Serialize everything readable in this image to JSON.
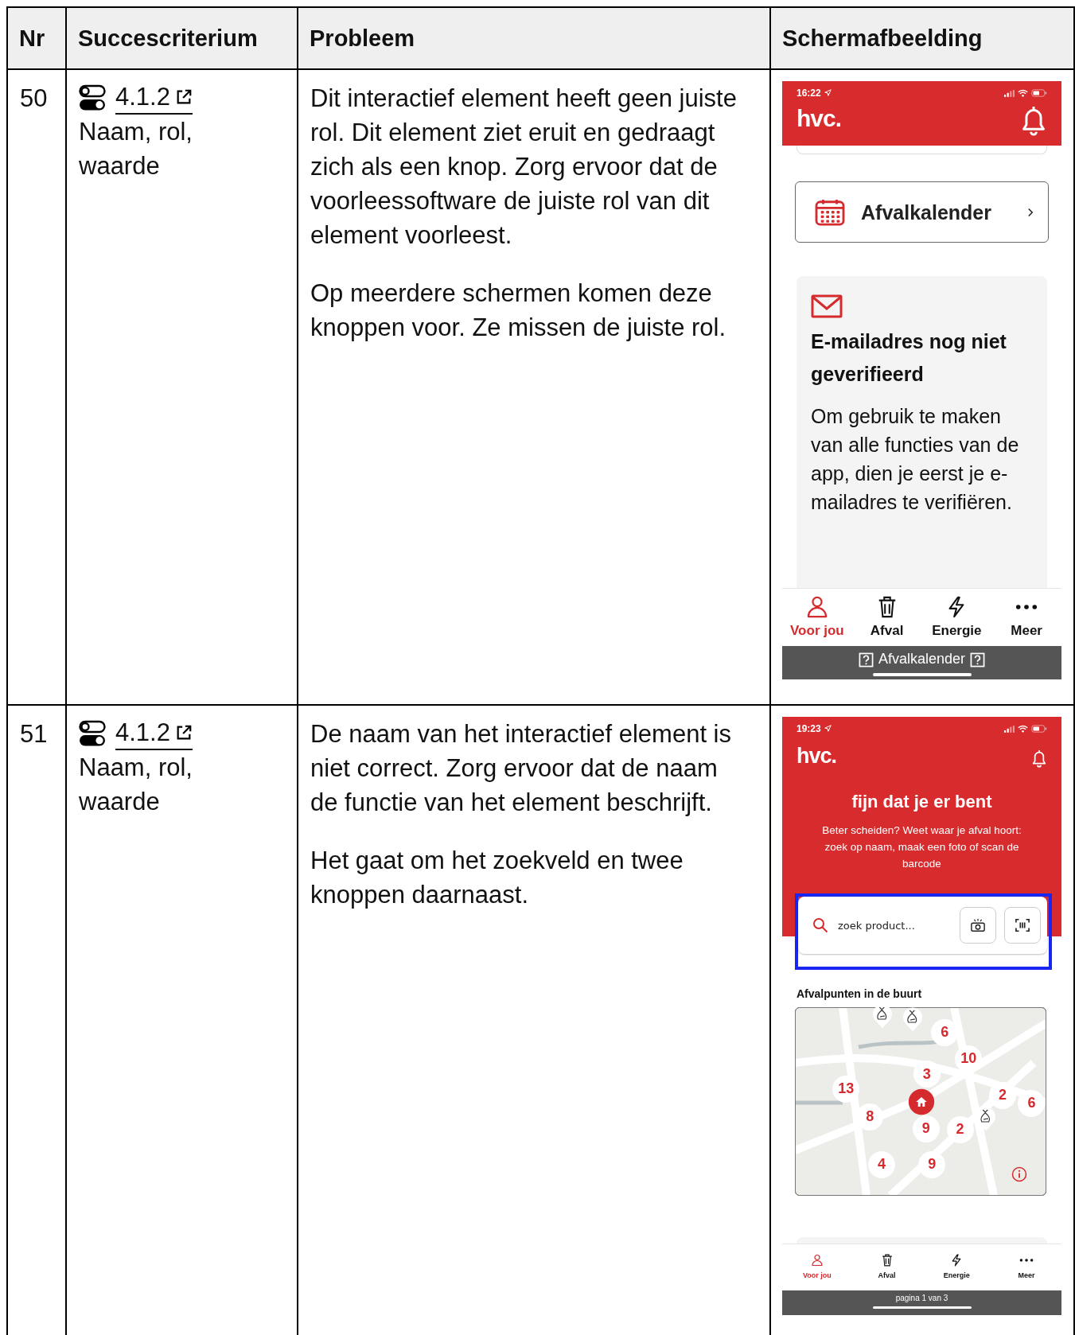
{
  "table": {
    "columns": [
      {
        "label": "Nr"
      },
      {
        "label": "Succescriterium"
      },
      {
        "label": "Probleem"
      },
      {
        "label": "Schermafbeelding"
      }
    ],
    "rows": [
      {
        "nr": "50",
        "criterion_link": "4.1.2",
        "criterion_name": "Naam, rol, waarde",
        "problem": [
          "Dit interactief element heeft geen juiste rol. Dit element ziet eruit en gedraagt zich als een knop. Zorg ervoor dat de voorleessoftware de juiste rol van dit element voorleest.",
          "Op meerdere schermen komen deze knoppen voor. Ze missen de juiste rol."
        ],
        "screenshot": {
          "kind": "card",
          "time": "16:22",
          "logo": "hvc.",
          "menu_button": "Afvalkalender",
          "notice_title": "E-mailadres nog niet geverifieerd",
          "notice_text": "Om gebruik te maken van alle functies van de app, dien je eerst je e-mailadres te verifiëren.",
          "tabs": [
            {
              "label": "Voor jou",
              "selected": true
            },
            {
              "label": "Afval",
              "selected": false
            },
            {
              "label": "Energie",
              "selected": false
            },
            {
              "label": "Meer",
              "selected": false
            }
          ],
          "caption": "Afvalkalender"
        }
      },
      {
        "nr": "51",
        "criterion_link": "4.1.2",
        "criterion_name": "Naam, rol, waarde",
        "problem": [
          "De naam van het interactief element is niet correct. Zorg ervoor dat de naam de functie van het element beschrijft.",
          "Het gaat om het zoekveld en twee knoppen daarnaast."
        ],
        "screenshot": {
          "kind": "search",
          "time": "19:23",
          "logo": "hvc.",
          "heading": "fijn dat je er bent",
          "intro": "Beter scheiden? Weet waar je afval hoort: zoek op naam, maak een foto of scan de barcode",
          "search_placeholder": "zoek product...",
          "highlighted": true,
          "map_title": "Afvalpunten in de buurt",
          "pins": [
            "6",
            "10",
            "3",
            "13",
            "2",
            "6",
            "8",
            "9",
            "2",
            "4",
            "9"
          ],
          "tabs": [
            {
              "label": "Voor jou",
              "selected": true
            },
            {
              "label": "Afval",
              "selected": false
            },
            {
              "label": "Energie",
              "selected": false
            },
            {
              "label": "Meer",
              "selected": false
            }
          ],
          "caption": "pagina 1 van 3"
        }
      }
    ]
  }
}
